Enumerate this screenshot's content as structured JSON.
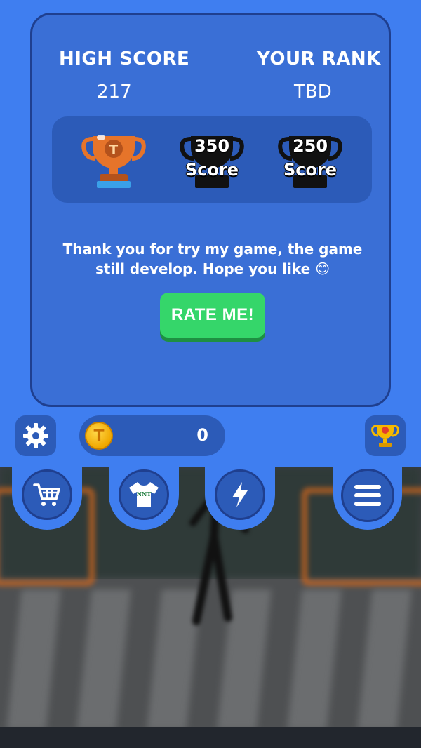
{
  "stats": {
    "high_score_label": "HIGH SCORE",
    "high_score_value": "217",
    "rank_label": "YOUR RANK",
    "rank_value": "TBD"
  },
  "trophies": [
    {
      "icon": "trophy-bronze-icon",
      "state": "unlocked"
    },
    {
      "icon": "trophy-locked-icon",
      "value": "350",
      "label": "Score"
    },
    {
      "icon": "trophy-locked-icon",
      "value": "250",
      "label": "Score"
    }
  ],
  "message": "Thank you for try my game, the game still develop. Hope you like 😊",
  "rate_button": "RATE ME!",
  "coins": {
    "icon": "coin-icon",
    "letter": "T",
    "count": "0"
  },
  "toolbar": {
    "settings_icon": "gear-icon",
    "leaderboard_icon": "trophy-icon"
  },
  "nav": [
    {
      "name": "shop",
      "icon": "cart-icon"
    },
    {
      "name": "skins",
      "icon": "tshirt-icon",
      "shirt_text": "NNT"
    },
    {
      "name": "powerups",
      "icon": "lightning-icon"
    },
    {
      "name": "menu",
      "icon": "hamburger-icon"
    }
  ],
  "colors": {
    "background": "#3f7ef0",
    "panel": "#3a6fd6",
    "panel_dark": "#2c5bb8",
    "button_green": "#35d66a",
    "coin": "#f0a800"
  }
}
